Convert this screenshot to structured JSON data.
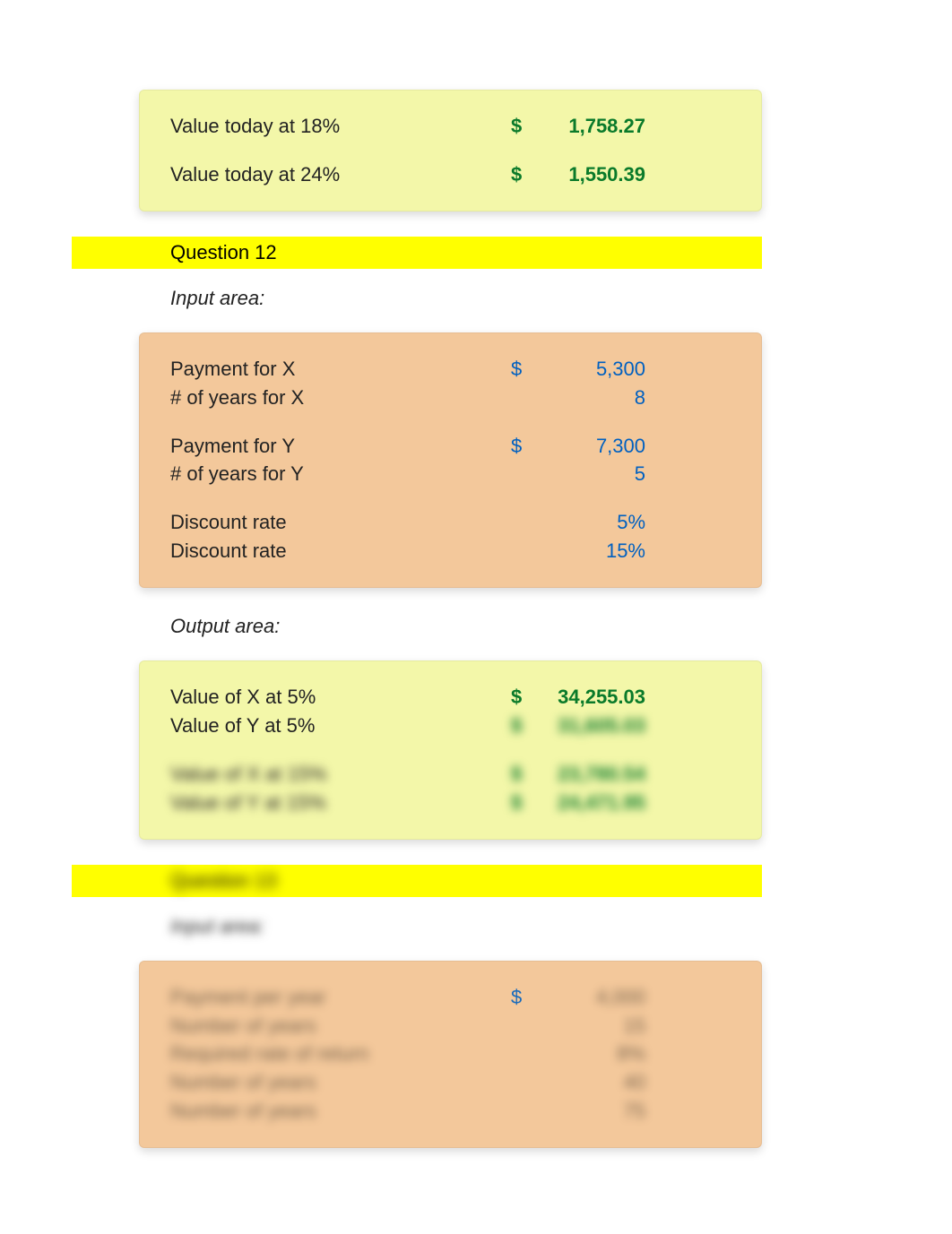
{
  "topPanel": {
    "rows": [
      {
        "label": "Value today at 18%",
        "currency": "$",
        "value": "1,758.27"
      },
      {
        "label": "Value today at 24%",
        "currency": "$",
        "value": "1,550.39"
      }
    ]
  },
  "q12": {
    "heading": "Question 12",
    "inputLabel": "Input area:",
    "inputs": [
      {
        "label": "Payment for X",
        "currency": "$",
        "value": "5,300"
      },
      {
        "label": "# of years for X",
        "currency": "",
        "value": "8"
      },
      {
        "label": "Payment for Y",
        "currency": "$",
        "value": "7,300"
      },
      {
        "label": "# of years for Y",
        "currency": "",
        "value": "5"
      },
      {
        "label": "Discount rate",
        "currency": "",
        "value": "5%"
      },
      {
        "label": "Discount rate",
        "currency": "",
        "value": "15%"
      }
    ],
    "outputLabel": "Output area:",
    "outputs": [
      {
        "label": "Value of X at 5%",
        "currency": "$",
        "value": "34,255.03"
      },
      {
        "label": "Value of Y at 5%",
        "currency": "$",
        "value": "31,605.03"
      },
      {
        "label": "Value of X at 15%",
        "currency": "$",
        "value": "23,780.54"
      },
      {
        "label": "Value of Y at 15%",
        "currency": "$",
        "value": "24,471.95"
      }
    ]
  },
  "q13": {
    "heading": "Question 13",
    "inputLabel": "Input area:",
    "inputs": [
      {
        "label": "Payment per year",
        "currency": "$",
        "value": "4,000"
      },
      {
        "label": "Number of years",
        "currency": "",
        "value": "15"
      },
      {
        "label": "Required rate of return",
        "currency": "",
        "value": "8%"
      },
      {
        "label": "Number of years",
        "currency": "",
        "value": "40"
      },
      {
        "label": "Number of years",
        "currency": "",
        "value": "75"
      }
    ]
  }
}
